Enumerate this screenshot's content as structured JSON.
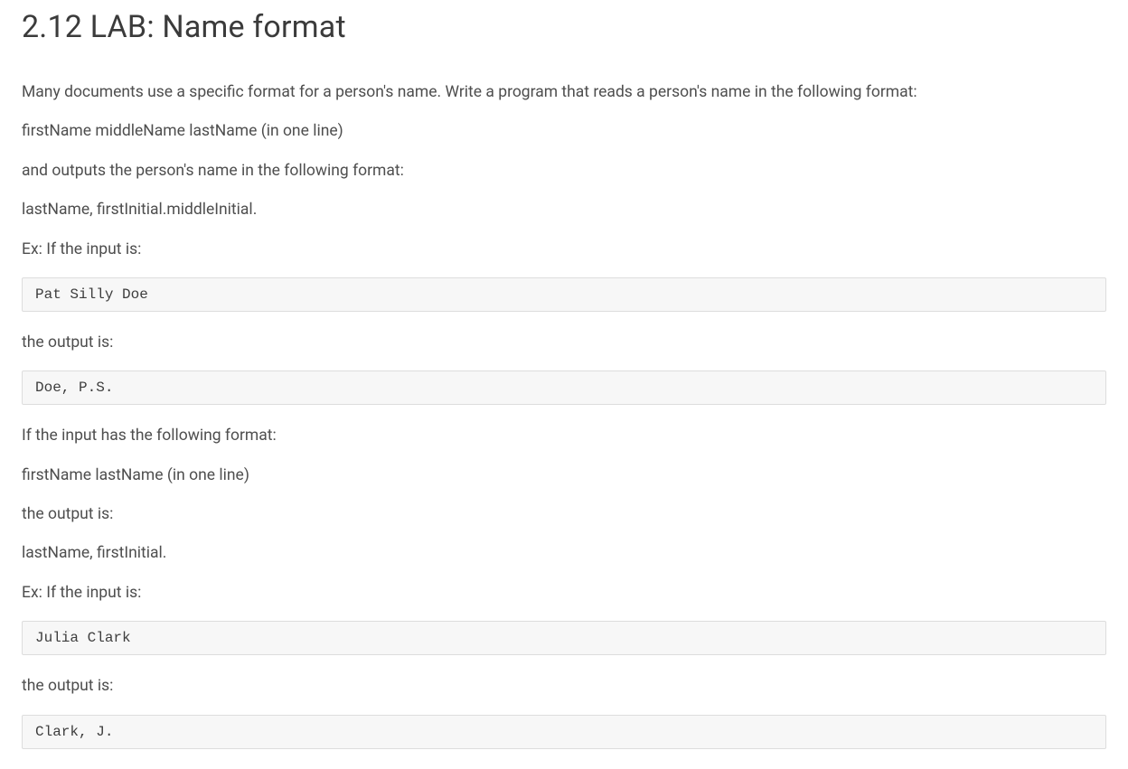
{
  "header": {
    "title": "2.12 LAB: Name format"
  },
  "paragraphs": {
    "p1": "Many documents use a specific format for a person's name. Write a program that reads a person's name in the following format:",
    "p2": "firstName middleName lastName (in one line)",
    "p3": "and outputs the person's name in the following format:",
    "p4": "lastName, firstInitial.middleInitial.",
    "p5": "Ex: If the input is:",
    "p6": "the output is:",
    "p7": "If the input has the following format:",
    "p8": "firstName lastName (in one line)",
    "p9": "the output is:",
    "p10": "lastName, firstInitial.",
    "p11": "Ex: If the input is:",
    "p12": "the output is:"
  },
  "codeblocks": {
    "c1": "Pat Silly Doe",
    "c2": "Doe, P.S.",
    "c3": "Julia Clark",
    "c4": "Clark, J."
  }
}
